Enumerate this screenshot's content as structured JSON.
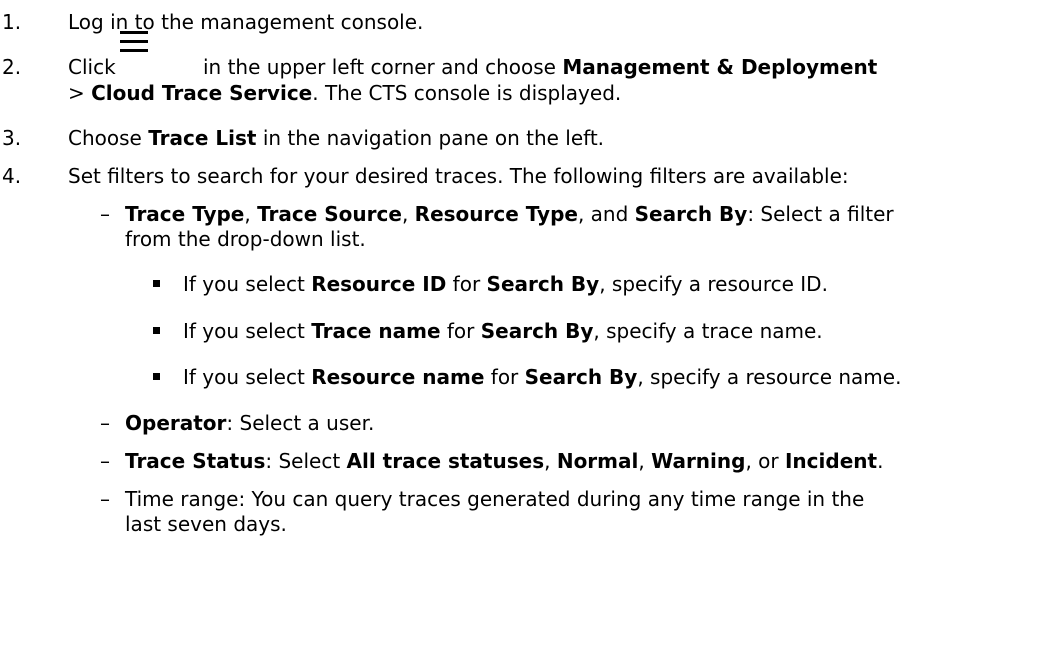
{
  "steps": [
    {
      "num": "1.",
      "text": "Log in to the management console."
    },
    {
      "num": "2.",
      "pre": "Click",
      "post": "in the upper left corner and choose",
      "b1": "Management & Deployment",
      "gt": ">",
      "b2": "Cloud Trace Service",
      "tail": ". The CTS console is displayed."
    },
    {
      "num": "3.",
      "pre": "Choose",
      "b1": "Trace List",
      "tail": " in the navigation pane on the left."
    },
    {
      "num": "4.",
      "text": "Set filters to search for your desired traces. The following filters are available:"
    }
  ],
  "icons": {
    "menu": "hamburger-menu-icon",
    "bullet": "square-bullet-icon",
    "dash": "en-dash"
  },
  "filters": {
    "dash": "–",
    "f1": {
      "b1": "Trace Type",
      "s1": ", ",
      "b2": "Trace Source",
      "s2": ", ",
      "b3": "Resource Type",
      "s3": ", and ",
      "b4": "Search By",
      "t1": ": Select a filter",
      "t2": "from the drop-down list."
    },
    "bullets": [
      {
        "pre": "If you select ",
        "b1": "Resource ID",
        "mid": " for ",
        "b2": "Search By",
        "post": ", specify a resource ID."
      },
      {
        "pre": "If you select ",
        "b1": "Trace name",
        "mid": " for ",
        "b2": "Search By",
        "post": ", specify a trace name."
      },
      {
        "pre": "If you select ",
        "b1": "Resource name",
        "mid": " for ",
        "b2": "Search By",
        "post": ", specify a resource name."
      }
    ],
    "f2": {
      "b1": "Operator",
      "post": ": Select a user."
    },
    "f3": {
      "b1": "Trace Status",
      "t1": ": Select ",
      "b2": "All trace statuses",
      "s1": ", ",
      "b3": "Normal",
      "s2": ", ",
      "b4": "Warning",
      "s3": ", or ",
      "b5": "Incident",
      "s4": "."
    },
    "f4": {
      "l1": "Time range: You can query traces generated during any time range in the",
      "l2": "last seven days."
    }
  }
}
